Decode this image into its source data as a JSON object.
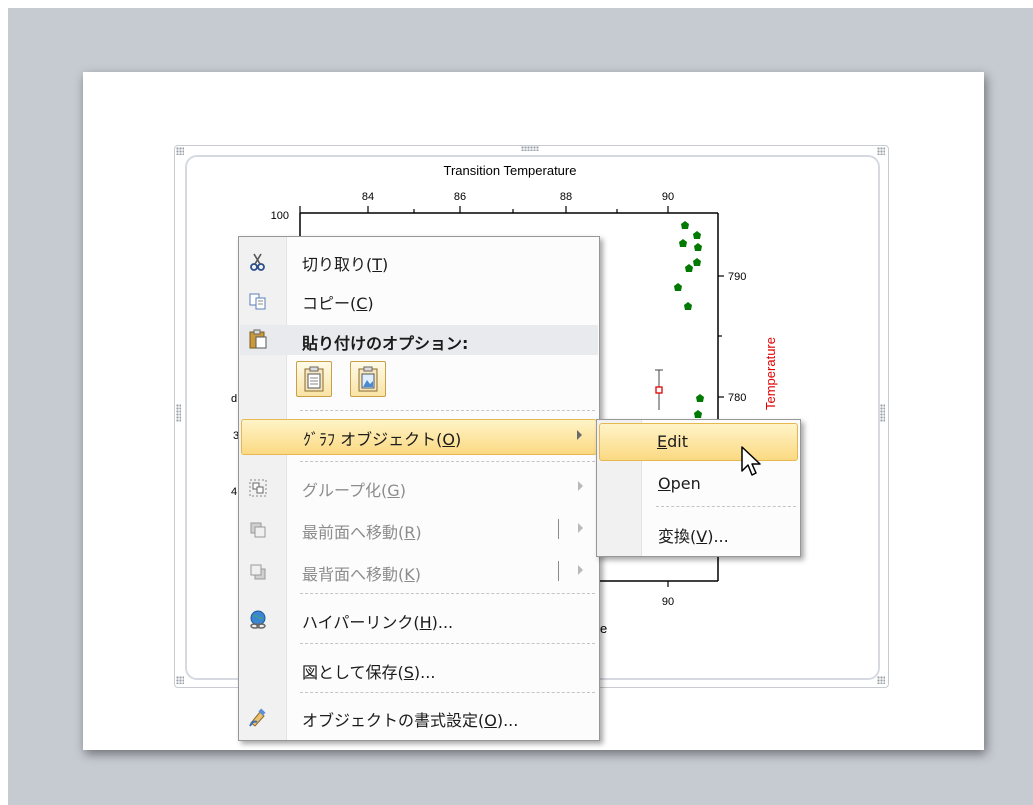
{
  "chart": {
    "title": "Transition Temperature",
    "top_ticks": [
      "84",
      "86",
      "88",
      "90"
    ],
    "bottom_tick": "90",
    "left_tick": "100",
    "right_ticks": [
      "790",
      "780"
    ],
    "right_axis_label_fragment": "Temperature",
    "bottom_label_fragment": "e",
    "left_fragments": [
      "d",
      "3",
      "4"
    ]
  },
  "context_menu": {
    "cut": {
      "text": "切り取り(",
      "key": "T",
      "end": ")"
    },
    "copy": {
      "text": "コピー(",
      "key": "C",
      "end": ")"
    },
    "paste_options_header": "貼り付けのオプション:",
    "graph_object": {
      "text": "ｸﾞﾗﾌ オブジェクト(",
      "key": "O",
      "end": ")"
    },
    "group": {
      "text": "グループ化(",
      "key": "G",
      "end": ")"
    },
    "bring_front": {
      "text": "最前面へ移動(",
      "key": "R",
      "end": ")"
    },
    "send_back": {
      "text": "最背面へ移動(",
      "key": "K",
      "end": ")"
    },
    "hyperlink": {
      "text": "ハイパーリンク(",
      "key": "H",
      "end": ")..."
    },
    "save_as_picture": {
      "text": "図として保存(",
      "key": "S",
      "end": ")..."
    },
    "format_object": {
      "text": "オブジェクトの書式設定(",
      "key": "O",
      "end": ")..."
    }
  },
  "submenu": {
    "edit": {
      "key": "E",
      "rest": "dit"
    },
    "open": {
      "key": "O",
      "rest": "pen"
    },
    "convert": {
      "text": "変換(",
      "key": "V",
      "end": ")..."
    }
  },
  "colors": {
    "highlight": "#fbd982",
    "scatter": "#007a00",
    "axis_label": "#e00000",
    "workspace": "#c6cbd2"
  }
}
